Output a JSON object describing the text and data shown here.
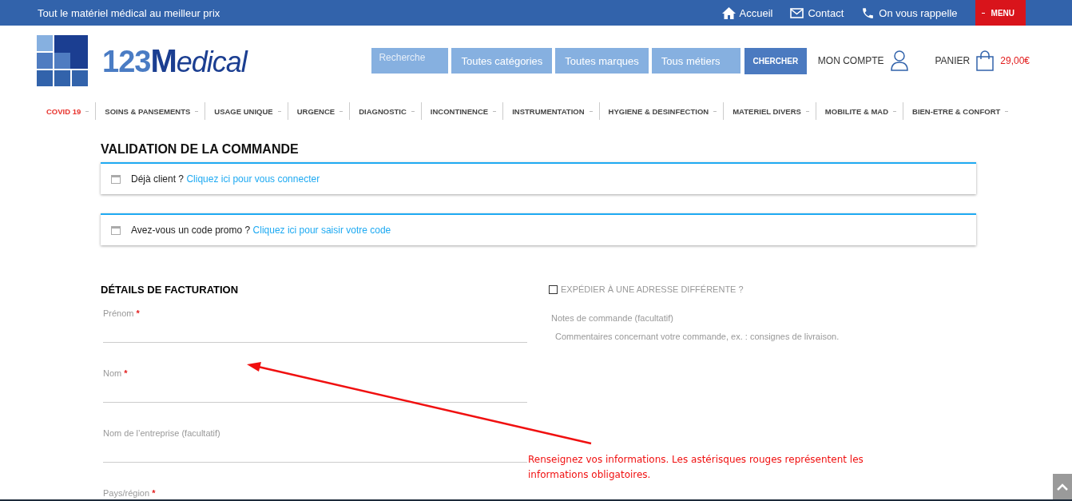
{
  "top_bar": {
    "tagline": "Tout le matériel médical au meilleur prix",
    "links": [
      {
        "kind": "home",
        "label": "Accueil"
      },
      {
        "kind": "mail",
        "label": "Contact"
      },
      {
        "kind": "phone",
        "label": "On vous rappelle"
      }
    ],
    "menu_button": "MENU"
  },
  "logo": {
    "number": "123",
    "word": "Medical"
  },
  "search": {
    "placeholder": "Recherche",
    "selects": [
      "Toutes catégories",
      "Toutes marques",
      "Tous métiers"
    ],
    "button": "CHERCHER"
  },
  "account": {
    "label": "MON COMPTE"
  },
  "cart": {
    "label": "PANIER",
    "total": "29,00€"
  },
  "nav": [
    {
      "label": "COVID 19",
      "selected": true
    },
    {
      "label": "SOINS & PANSEMENTS",
      "selected": false
    },
    {
      "label": "USAGE UNIQUE",
      "selected": false
    },
    {
      "label": "URGENCE",
      "selected": false
    },
    {
      "label": "DIAGNOSTIC",
      "selected": false
    },
    {
      "label": "INCONTINENCE",
      "selected": false
    },
    {
      "label": "INSTRUMENTATION",
      "selected": false
    },
    {
      "label": "HYGIENE & DESINFECTION",
      "selected": false
    },
    {
      "label": "MATERIEL DIVERS",
      "selected": false
    },
    {
      "label": "MOBILITE & MAD",
      "selected": false
    },
    {
      "label": "BIEN-ETRE & CONFORT",
      "selected": false
    }
  ],
  "page_title": "VALIDATION DE LA COMMANDE",
  "notices": [
    {
      "text": "Déjà client ?",
      "link": "Cliquez ici pour vous connecter"
    },
    {
      "text": "Avez-vous un code promo ?",
      "link": "Cliquez ici pour saisir votre code"
    }
  ],
  "billing": {
    "title": "DÉTAILS DE FACTURATION",
    "fields": [
      {
        "label": "Prénom",
        "required_mark": "*"
      },
      {
        "label": "Nom",
        "required_mark": "*"
      },
      {
        "label": "Nom de l’entreprise (facultatif)"
      },
      {
        "label": "Pays/région",
        "required_mark": "*"
      }
    ]
  },
  "shipping": {
    "checkbox_label": "EXPÉDIER À UNE ADRESSE DIFFÉRENTE ?",
    "checked": false,
    "notes_label": "Notes de commande (facultatif)",
    "notes_placeholder": "Commentaires concernant votre commande, ex. : consignes de livraison."
  },
  "annotation": {
    "text": "Renseignez vos informations. Les astérisques rouges représentent les informations obligatoires."
  }
}
